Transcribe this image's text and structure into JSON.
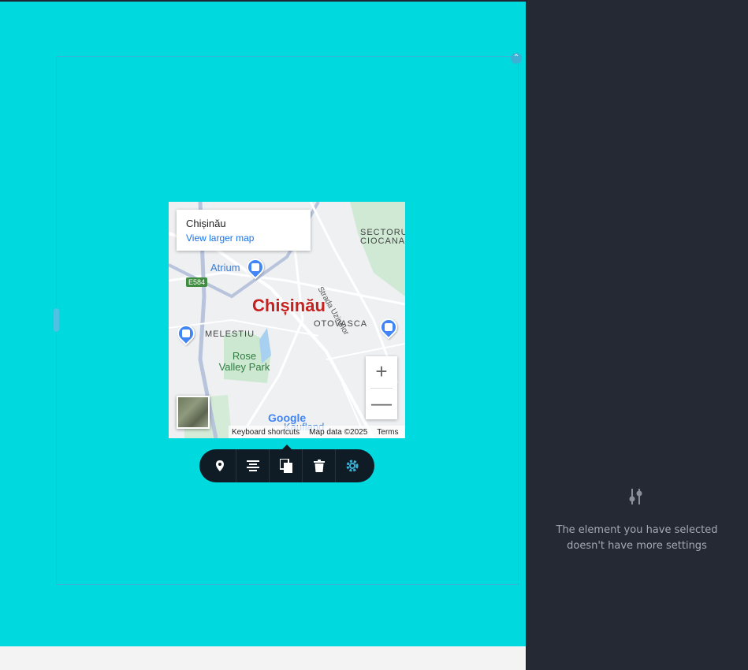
{
  "map": {
    "info_title": "Chișinău",
    "info_link": "View larger map",
    "city_label": "Chișinău",
    "districts": [
      "SECTORUL",
      "CIOCANA",
      "OTOVASCA",
      "MELESTIU"
    ],
    "park": "Rose Valley Park",
    "poi_atrium": "Atrium",
    "poi_kaufland": "Kaufland",
    "road": "Strada Uzinelor",
    "road_shield": "E584",
    "logo": "Google",
    "attribution": [
      "Keyboard shortcuts",
      "Map data ©2025",
      "Terms"
    ],
    "zoom_in": "+",
    "zoom_out": "—"
  },
  "toolbar": {
    "items": [
      "location-pin-icon",
      "align-icon",
      "duplicate-icon",
      "delete-icon",
      "settings-icon"
    ]
  },
  "panel": {
    "message": "The element you have selected doesn't have more settings"
  },
  "colors": {
    "canvas": "#00dadf",
    "panel": "#252933",
    "accent": "#3cb1d6",
    "toolbar": "#0f1b25"
  }
}
